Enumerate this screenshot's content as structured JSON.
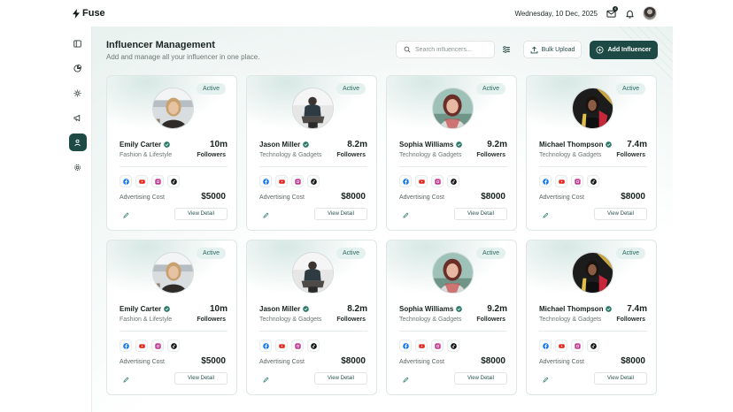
{
  "app": {
    "name": "Fuse"
  },
  "header": {
    "date": "Wednesday, 10 Dec, 2025",
    "mail_badge": "4"
  },
  "page": {
    "title": "Influencer Management",
    "subtitle": "Add and manage all your influencer in one place."
  },
  "toolbar": {
    "search_placeholder": "Search influencers...",
    "bulk_upload_label": "Bulk Upload",
    "add_label": "Add Influencer"
  },
  "colors": {
    "accent": "#1d4a45",
    "status_bg": "#e4f1ee",
    "status_text": "#2a6a60"
  },
  "sidebar": {
    "items": [
      {
        "icon": "panel-icon",
        "active": false
      },
      {
        "icon": "chart-icon",
        "active": false
      },
      {
        "icon": "sun-icon",
        "active": false
      },
      {
        "icon": "megaphone-icon",
        "active": false
      },
      {
        "icon": "users-icon",
        "active": true
      },
      {
        "icon": "gear-icon",
        "active": false
      }
    ]
  },
  "cards": [
    {
      "status": "Active",
      "name": "Emily Carter",
      "category": "Fashion & Lifestyle",
      "followers": "10m",
      "followers_label": "Followers",
      "cost_label": "Advertising Cost",
      "cost": "$5000",
      "view_label": "View Detail"
    },
    {
      "status": "Active",
      "name": "Jason Miller",
      "category": "Technology & Gadgets",
      "followers": "8.2m",
      "followers_label": "Followers",
      "cost_label": "Advertising Cost",
      "cost": "$8000",
      "view_label": "View Detail"
    },
    {
      "status": "Active",
      "name": "Sophia Williams",
      "category": "Technology & Gadgets",
      "followers": "9.2m",
      "followers_label": "Followers",
      "cost_label": "Advertising Cost",
      "cost": "$8000",
      "view_label": "View Detail"
    },
    {
      "status": "Active",
      "name": "Michael Thompson",
      "category": "Technology & Gadgets",
      "followers": "7.4m",
      "followers_label": "Followers",
      "cost_label": "Advertising Cost",
      "cost": "$8000",
      "view_label": "View Detail"
    },
    {
      "status": "Active",
      "name": "Emily Carter",
      "category": "Fashion & Lifestyle",
      "followers": "10m",
      "followers_label": "Followers",
      "cost_label": "Advertising Cost",
      "cost": "$5000",
      "view_label": "View Detail"
    },
    {
      "status": "Active",
      "name": "Jason Miller",
      "category": "Technology & Gadgets",
      "followers": "8.2m",
      "followers_label": "Followers",
      "cost_label": "Advertising Cost",
      "cost": "$8000",
      "view_label": "View Detail"
    },
    {
      "status": "Active",
      "name": "Sophia Williams",
      "category": "Technology & Gadgets",
      "followers": "9.2m",
      "followers_label": "Followers",
      "cost_label": "Advertising Cost",
      "cost": "$8000",
      "view_label": "View Detail"
    },
    {
      "status": "Active",
      "name": "Michael Thompson",
      "category": "Technology & Gadgets",
      "followers": "7.4m",
      "followers_label": "Followers",
      "cost_label": "Advertising Cost",
      "cost": "$8000",
      "view_label": "View Detail"
    }
  ]
}
